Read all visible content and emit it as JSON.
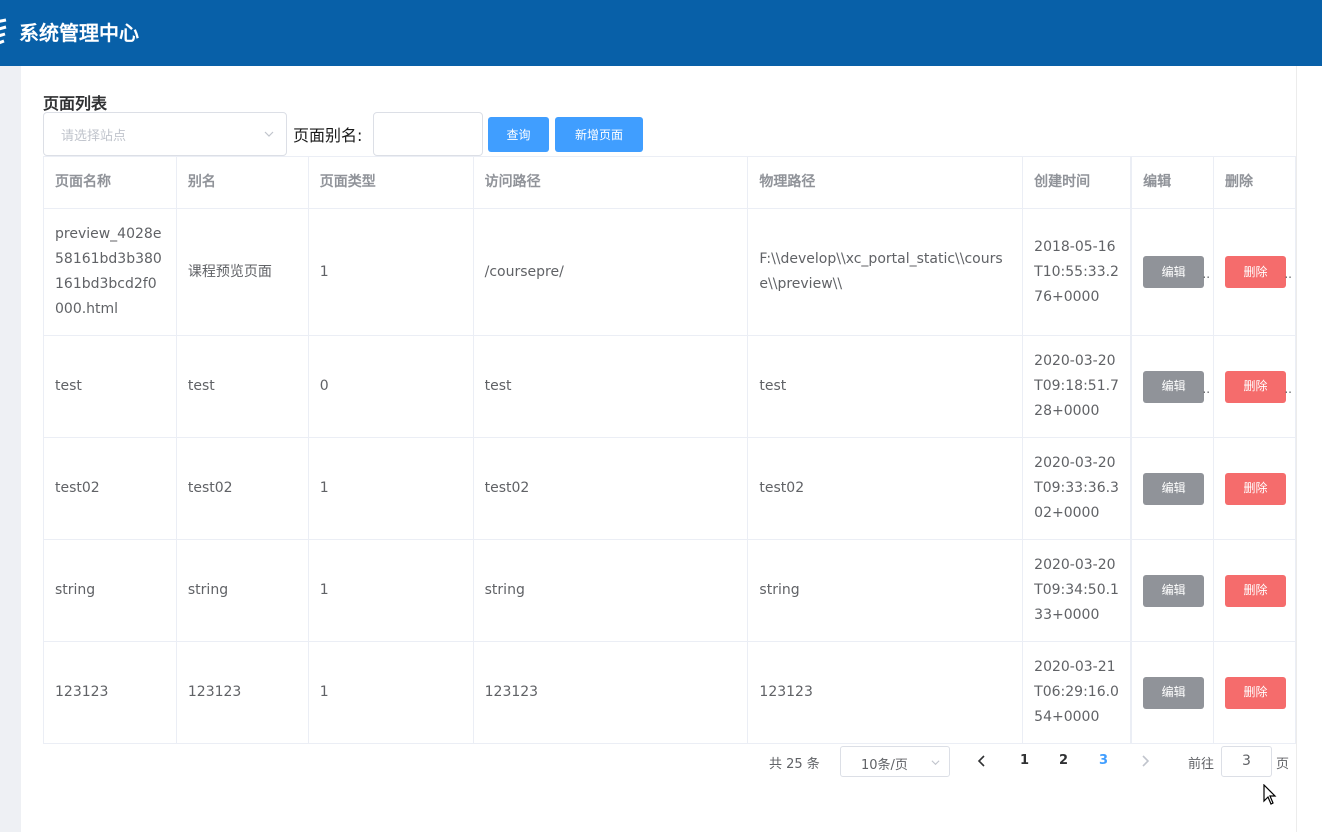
{
  "header": {
    "title": "系统管理中心",
    "logo_icon": "logo-icon",
    "bg_color": "#0860a8"
  },
  "page": {
    "title": "页面列表"
  },
  "filters": {
    "site_select_placeholder": "请选择站点",
    "alias_label": "页面别名:",
    "alias_value": "",
    "query_label": "查询",
    "add_label": "新增页面"
  },
  "table": {
    "columns": [
      "页面名称",
      "别名",
      "页面类型",
      "访问路径",
      "物理路径",
      "创建时间",
      "编辑",
      "删除"
    ],
    "edit_label": "编辑",
    "delete_label": "删除",
    "rows": [
      {
        "name": "preview_4028e58161bd3b380161bd3bcd2f0000.html",
        "alias": "课程预览页面",
        "type": "1",
        "web_path": "/coursepre/",
        "physical_path": "F:\\\\develop\\\\xc_portal_static\\\\course\\\\preview\\\\",
        "created": "2018-05-16T10:55:33.276+0000"
      },
      {
        "name": "test",
        "alias": "test",
        "type": "0",
        "web_path": "test",
        "physical_path": "test",
        "created": "2020-03-20T09:18:51.728+0000"
      },
      {
        "name": "test02",
        "alias": "test02",
        "type": "1",
        "web_path": "test02",
        "physical_path": "test02",
        "created": "2020-03-20T09:33:36.302+0000"
      },
      {
        "name": "string",
        "alias": "string",
        "type": "1",
        "web_path": "string",
        "physical_path": "string",
        "created": "2020-03-20T09:34:50.133+0000"
      },
      {
        "name": "123123",
        "alias": "123123",
        "type": "1",
        "web_path": "123123",
        "physical_path": "123123",
        "created": "2020-03-21T06:29:16.054+0000"
      }
    ]
  },
  "pagination": {
    "total": "共 25 条",
    "page_size": "10条/页",
    "pages": [
      "1",
      "2",
      "3"
    ],
    "current": "3",
    "goto_label": "前往",
    "goto_value": "3",
    "page_suffix": "页"
  },
  "colors": {
    "primary": "#409eff",
    "danger": "#f56c6c",
    "info": "#909399"
  }
}
